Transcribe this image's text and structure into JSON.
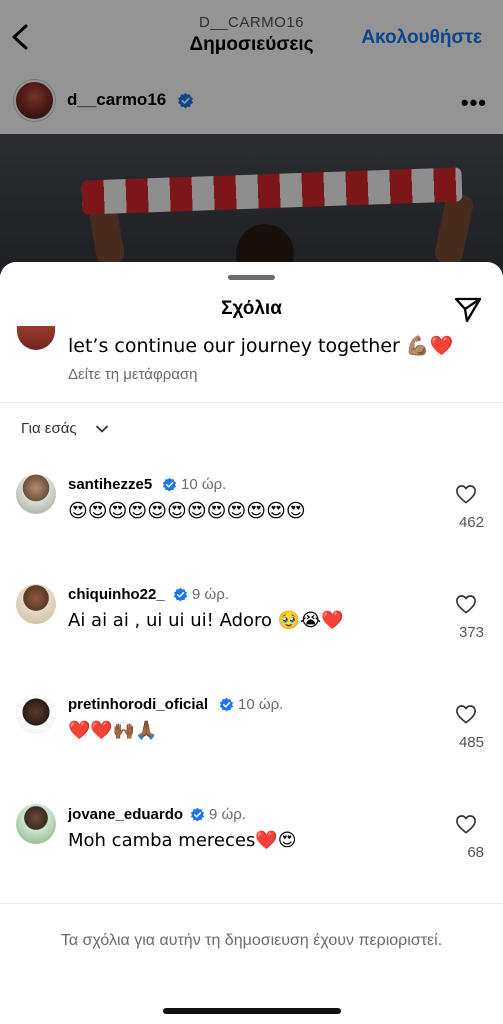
{
  "nav": {
    "username": "D__CARMO16",
    "title": "Δημοσιεύσεις",
    "follow_label": "Ακολουθήστε"
  },
  "post": {
    "username": "d__carmo16",
    "more_label": "•••"
  },
  "sheet": {
    "title": "Σχόλια",
    "caption_text": "let’s continue our journey together 💪🏽❤️",
    "translate_label": "Δείτε τη μετάφραση",
    "filter_label": "Για εσάς",
    "restricted_text": "Τα σχόλια για αυτήν τη δημοσιευση έχουν περιοριστεί."
  },
  "comments": [
    {
      "username": "santihezze5",
      "time": "10 ώρ.",
      "text": "😍😍😍😍😍😍😍😍😍😍😍😍",
      "likes": "462"
    },
    {
      "username": "chiquinho22_",
      "time": "9 ώρ.",
      "text": "Ai ai ai , ui ui ui! Adoro 🥹😭❤️",
      "likes": "373"
    },
    {
      "username": "pretinhorodi_oficial",
      "time": "10 ώρ.",
      "text": "❤️❤️🙌🏾🙏🏾",
      "likes": "485"
    },
    {
      "username": "jovane_eduardo",
      "time": "9 ώρ.",
      "text": "Moh camba mereces❤️😍",
      "likes": "68"
    }
  ],
  "colors": {
    "accent": "#1877f2",
    "verified": "#1877f2",
    "secondary_text": "#6b6b6b"
  },
  "icons": [
    "back-icon",
    "verified-icon",
    "more-icon",
    "send-icon",
    "chevron-down-icon",
    "heart-icon"
  ]
}
